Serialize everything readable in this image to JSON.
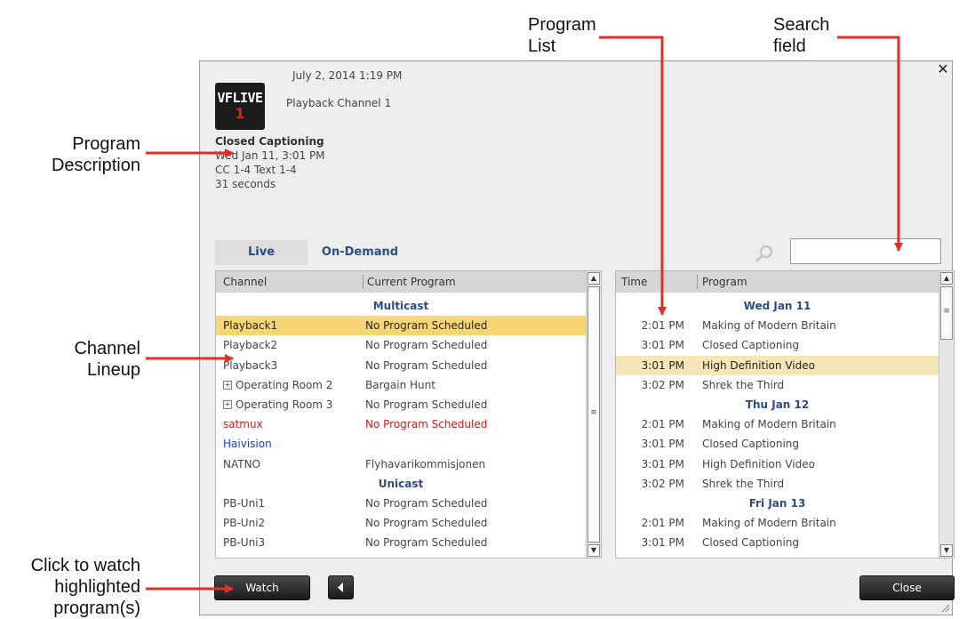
{
  "callouts": {
    "program_description": [
      "Program",
      "Description"
    ],
    "channel_lineup": [
      "Channel",
      "Lineup"
    ],
    "watch": [
      "Click to watch",
      "highlighted",
      "program(s)"
    ],
    "program_list": [
      "Program",
      "List"
    ],
    "search_field": [
      "Search",
      "field"
    ]
  },
  "header": {
    "datetime": "July 2, 2014 1:19 PM",
    "logo_line1": "VFLIVE",
    "logo_line2": "1",
    "channel_name": "Playback Channel 1"
  },
  "description": {
    "title": "Closed Captioning",
    "when": "Wed Jan 11, 3:01 PM",
    "captions": "CC 1-4 Text 1-4",
    "duration": "31 seconds"
  },
  "tabs": {
    "live": "Live",
    "on_demand": "On-Demand"
  },
  "search": {
    "value": "",
    "placeholder": ""
  },
  "channels": {
    "headers": {
      "channel": "Channel",
      "current_program": "Current Program"
    },
    "rows": [
      {
        "group": "Multicast"
      },
      {
        "channel": "Playback1",
        "program": "No Program Scheduled",
        "selected": true
      },
      {
        "channel": "Playback2",
        "program": "No Program Scheduled"
      },
      {
        "channel": "Playback3",
        "program": "No Program Scheduled"
      },
      {
        "channel": "Operating Room 2",
        "program": "Bargain Hunt",
        "expandable": true
      },
      {
        "channel": "Operating Room 3",
        "program": "No Program Scheduled",
        "expandable": true
      },
      {
        "channel": "satmux",
        "program": "No Program Scheduled",
        "color": "#c0201c"
      },
      {
        "channel": "Haivision",
        "program": "",
        "color": "#1a3ad6"
      },
      {
        "channel": "NATNO",
        "program": "Flyhavarikommisjonen"
      },
      {
        "group": "Unicast"
      },
      {
        "channel": "PB-Uni1",
        "program": "No Program Scheduled"
      },
      {
        "channel": "PB-Uni2",
        "program": "No Program Scheduled"
      },
      {
        "channel": "PB-Uni3",
        "program": "No Program Scheduled"
      }
    ]
  },
  "programs": {
    "headers": {
      "time": "Time",
      "program": "Program"
    },
    "rows": [
      {
        "group": "Wed Jan 11"
      },
      {
        "time": "2:01 PM",
        "program": "Making of Modern Britain"
      },
      {
        "time": "3:01 PM",
        "program": "Closed Captioning"
      },
      {
        "time": "3:01 PM",
        "program": "High Definition Video",
        "selected": true
      },
      {
        "time": "3:02 PM",
        "program": "Shrek the Third"
      },
      {
        "group": "Thu Jan 12"
      },
      {
        "time": "2:01 PM",
        "program": "Making of Modern Britain"
      },
      {
        "time": "3:01 PM",
        "program": "Closed Captioning"
      },
      {
        "time": "3:01 PM",
        "program": "High Definition Video"
      },
      {
        "time": "3:02 PM",
        "program": "Shrek the Third"
      },
      {
        "group": "Fri Jan 13"
      },
      {
        "time": "2:01 PM",
        "program": "Making of Modern Britain"
      },
      {
        "time": "3:01 PM",
        "program": "Closed Captioning"
      }
    ]
  },
  "buttons": {
    "watch": "Watch",
    "close": "Close"
  },
  "icons": {
    "close": "close-icon",
    "search": "search-icon",
    "back": "triangle-left-icon",
    "expand": "plus-box-icon",
    "resize": "resize-grip-icon"
  },
  "colors": {
    "accent": "#2b4c86",
    "selected_row": "#f8d675",
    "selected_program": "#f7e7b7",
    "arrow": "#e42d28"
  }
}
